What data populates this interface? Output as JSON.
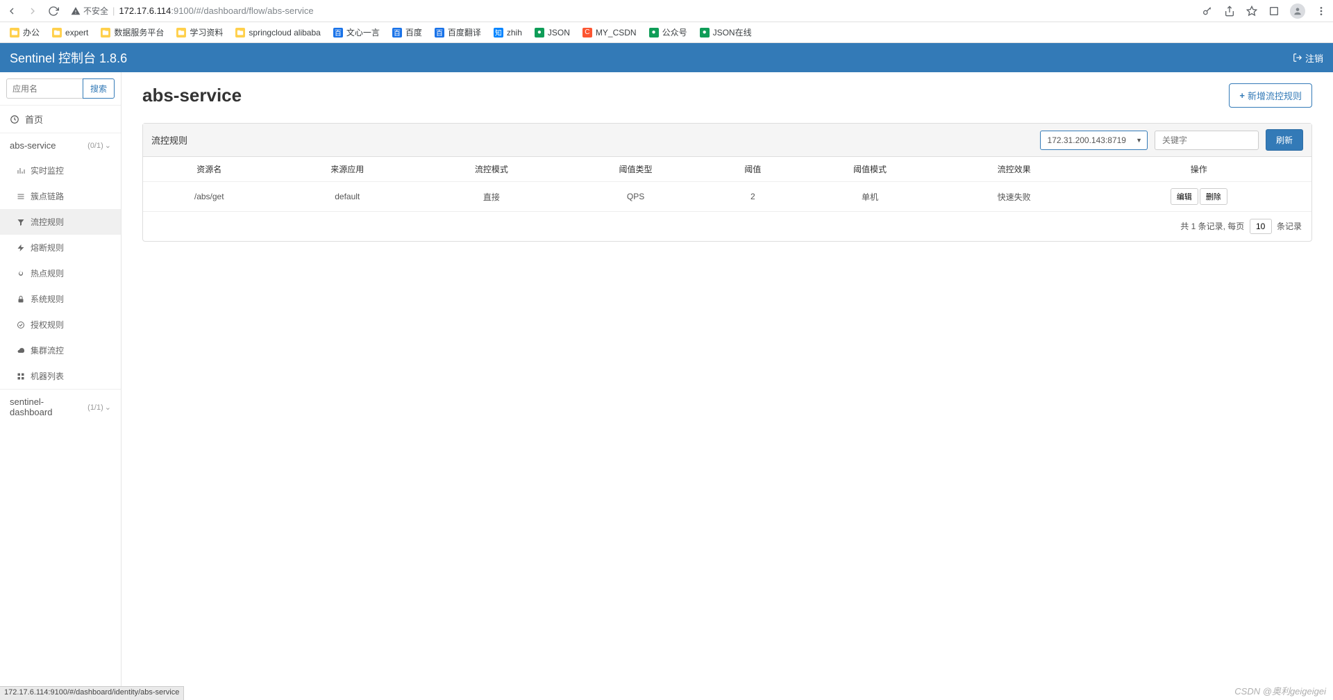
{
  "browser": {
    "insecure_label": "不安全",
    "url_host": "172.17.6.114",
    "url_port_path": ":9100/#/dashboard/flow/abs-service"
  },
  "bookmarks": [
    {
      "label": "办公",
      "type": "folder"
    },
    {
      "label": "expert",
      "type": "folder"
    },
    {
      "label": "数据服务平台",
      "type": "folder"
    },
    {
      "label": "学习资料",
      "type": "folder"
    },
    {
      "label": "springcloud alibaba",
      "type": "folder"
    },
    {
      "label": "文心一言",
      "type": "blue"
    },
    {
      "label": "百度",
      "type": "blue"
    },
    {
      "label": "百度翻译",
      "type": "blue"
    },
    {
      "label": "zhih",
      "type": "zhihu"
    },
    {
      "label": "JSON",
      "type": "green"
    },
    {
      "label": "MY_CSDN",
      "type": "csdn"
    },
    {
      "label": "公众号",
      "type": "green"
    },
    {
      "label": "JSON在线",
      "type": "green"
    }
  ],
  "header": {
    "title": "Sentinel 控制台 1.8.6",
    "logout": "注销"
  },
  "sidebar": {
    "search_placeholder": "应用名",
    "search_btn": "搜索",
    "home": "首页",
    "apps": [
      {
        "name": "abs-service",
        "count": "(0/1)"
      },
      {
        "name": "sentinel-dashboard",
        "count": "(1/1)"
      }
    ],
    "menu": [
      {
        "label": "实时监控",
        "icon": "chart"
      },
      {
        "label": "簇点链路",
        "icon": "list"
      },
      {
        "label": "流控规则",
        "icon": "filter",
        "active": true
      },
      {
        "label": "熔断规则",
        "icon": "bolt"
      },
      {
        "label": "热点规则",
        "icon": "fire"
      },
      {
        "label": "系统规则",
        "icon": "lock"
      },
      {
        "label": "授权规则",
        "icon": "check"
      },
      {
        "label": "集群流控",
        "icon": "cloud"
      },
      {
        "label": "机器列表",
        "icon": "grid"
      }
    ]
  },
  "page": {
    "title": "abs-service",
    "add_btn": "新增流控规则",
    "card_title": "流控规则",
    "machine_select": "172.31.200.143:8719",
    "keyword_placeholder": "关键字",
    "refresh_btn": "刷新",
    "columns": [
      "资源名",
      "来源应用",
      "流控模式",
      "阈值类型",
      "阈值",
      "阈值模式",
      "流控效果",
      "操作"
    ],
    "rows": [
      {
        "resource": "/abs/get",
        "origin": "default",
        "mode": "直接",
        "thresh_type": "QPS",
        "thresh": "2",
        "thresh_mode": "单机",
        "effect": "快速失败"
      }
    ],
    "row_actions": {
      "edit": "编辑",
      "delete": "删除"
    },
    "footer_prefix": "共 1 条记录, 每页",
    "footer_value": "10",
    "footer_suffix": "条记录"
  },
  "status_bar": "172.17.6.114:9100/#/dashboard/identity/abs-service",
  "watermark": "CSDN @奥利geigeigei"
}
